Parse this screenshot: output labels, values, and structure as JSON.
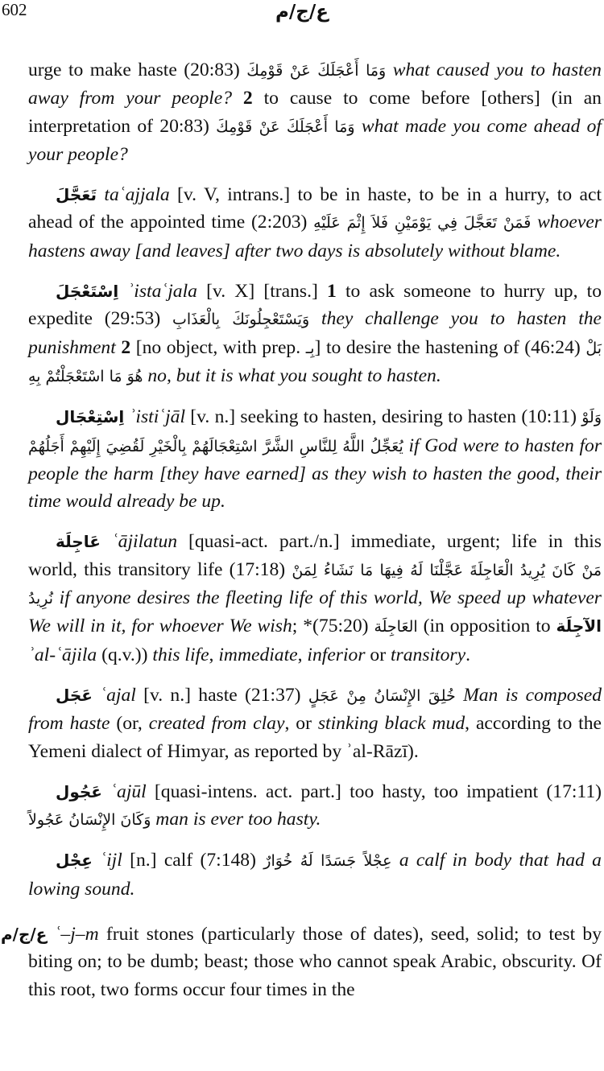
{
  "page_number": "602",
  "running_head": "ع/ج/م",
  "entries": [
    {
      "parts": [
        {
          "t": "urge to make haste (20:83) ",
          "s": ""
        },
        {
          "t": "وَمَا أَعْجَلَكَ عَنْ قَوْمِكَ",
          "s": "ar"
        },
        {
          "t": " ",
          "s": ""
        },
        {
          "t": "what caused you to hasten away from your people?",
          "s": "en"
        },
        {
          "t": " ",
          "s": ""
        },
        {
          "t": "2",
          "s": "b"
        },
        {
          "t": " to cause to come before [others] (in an interpretation of 20:83) ",
          "s": ""
        },
        {
          "t": "وَمَا أَعْجَلَكَ عَنْ قَوْمِكَ",
          "s": "ar"
        },
        {
          "t": " ",
          "s": ""
        },
        {
          "t": "what made you come ahead of your people?",
          "s": "en"
        }
      ]
    },
    {
      "parts": [
        {
          "t": "تَعَجَّلَ",
          "s": "ah"
        },
        {
          "t": " ",
          "s": ""
        },
        {
          "t": "taʿajjala",
          "s": "tr"
        },
        {
          "t": " [v. V, intrans.] to be in haste, to be in a hurry, to act ahead of the appointed time (2:203) ",
          "s": ""
        },
        {
          "t": "فَمَنْ تَعَجَّلَ فِي يَوْمَيْنِ فَلاَ إِثْمَ عَلَيْهِ",
          "s": "ar"
        },
        {
          "t": " ",
          "s": ""
        },
        {
          "t": "whoever hastens away [and leaves] after two days is absolutely without blame.",
          "s": "en"
        }
      ]
    },
    {
      "parts": [
        {
          "t": "اِسْتَعْجَلَ",
          "s": "ah"
        },
        {
          "t": " ",
          "s": ""
        },
        {
          "t": "ʾistaʿjala",
          "s": "tr"
        },
        {
          "t": " [v. X] [trans.] ",
          "s": ""
        },
        {
          "t": "1",
          "s": "b"
        },
        {
          "t": " to ask someone to hurry up, to expedite (29:53) ",
          "s": ""
        },
        {
          "t": "وَيَسْتَعْجِلُونَكَ بِالْعَذَابِ",
          "s": "ar"
        },
        {
          "t": " ",
          "s": ""
        },
        {
          "t": "they challenge you to hasten the punishment",
          "s": "en"
        },
        {
          "t": " ",
          "s": ""
        },
        {
          "t": "2",
          "s": "b"
        },
        {
          "t": " [no object, with prep. ",
          "s": ""
        },
        {
          "t": "بِـ",
          "s": "ar"
        },
        {
          "t": "]  to desire the hastening of (46:24) ",
          "s": ""
        },
        {
          "t": "بَلْ هُوَ مَا اسْتَعْجَلْتُمْ بِهِ",
          "s": "ar"
        },
        {
          "t": " ",
          "s": ""
        },
        {
          "t": "no, but it is what you sought to hasten.",
          "s": "en"
        }
      ]
    },
    {
      "parts": [
        {
          "t": "اِسْتِعْجَال",
          "s": "ah"
        },
        {
          "t": " ",
          "s": ""
        },
        {
          "t": "ʾistiʿjāl",
          "s": "tr"
        },
        {
          "t": " [v. n.] seeking to hasten, desiring to hasten (10:11) ",
          "s": ""
        },
        {
          "t": "وَلَوْ يُعَجِّلُ اللَّهُ لِلنَّاسِ الشَّرَّ اسْتِعْجَالَهُمْ بِالْخَيْرِ لَقُضِيَ إِلَيْهِمْ أَجَلُهُمْ",
          "s": "ar"
        },
        {
          "t": " ",
          "s": ""
        },
        {
          "t": "if God were to hasten for people the harm [they have earned] as they wish to hasten the good, their time would already be up.",
          "s": "en"
        }
      ]
    },
    {
      "parts": [
        {
          "t": "عَاجِلَة",
          "s": "ah"
        },
        {
          "t": " ",
          "s": ""
        },
        {
          "t": "ʿājilatun",
          "s": "tr"
        },
        {
          "t": " [quasi-act. part./n.] immediate, urgent; life in this world, this transitory life (17:18) ",
          "s": ""
        },
        {
          "t": "مَنْ كَانَ يُرِيدُ الْعَاجِلَةَ عَجَّلْنَا لَهُ فِيهَا مَا نَشَاءُ لِمَنْ نُرِيدُ",
          "s": "ar"
        },
        {
          "t": " ",
          "s": ""
        },
        {
          "t": "if anyone desires the fleeting life of this world, We speed up whatever We will in it, for whoever We wish",
          "s": "en"
        },
        {
          "t": "; *(75:20) ",
          "s": ""
        },
        {
          "t": "العَاجِلَة",
          "s": "ar"
        },
        {
          "t": " (in opposition to ",
          "s": ""
        },
        {
          "t": "الآجِلَة",
          "s": "ah"
        },
        {
          "t": " ",
          "s": ""
        },
        {
          "t": "ʾal-ʿājila",
          "s": "tr"
        },
        {
          "t": " (q.v.)) ",
          "s": ""
        },
        {
          "t": "this life",
          "s": "en"
        },
        {
          "t": ", ",
          "s": ""
        },
        {
          "t": "immediate",
          "s": "en"
        },
        {
          "t": ", ",
          "s": ""
        },
        {
          "t": "inferior",
          "s": "en"
        },
        {
          "t": " or ",
          "s": ""
        },
        {
          "t": "transitory",
          "s": "en"
        },
        {
          "t": ".",
          "s": ""
        }
      ]
    },
    {
      "parts": [
        {
          "t": "عَجَل",
          "s": "ah"
        },
        {
          "t": " ",
          "s": ""
        },
        {
          "t": "ʿajal",
          "s": "tr"
        },
        {
          "t": " [v. n.] haste (21:37) ",
          "s": ""
        },
        {
          "t": "خُلِقَ الإِنْسَانُ مِنْ عَجَلٍ",
          "s": "ar"
        },
        {
          "t": " ",
          "s": ""
        },
        {
          "t": "Man is composed from haste",
          "s": "en"
        },
        {
          "t": " (or, ",
          "s": ""
        },
        {
          "t": "created from clay",
          "s": "en"
        },
        {
          "t": ", or ",
          "s": ""
        },
        {
          "t": "stinking black mud",
          "s": "en"
        },
        {
          "t": ", according to the Yemeni dialect of Himyar, as reported by ʾal-Rāzī).",
          "s": ""
        }
      ]
    },
    {
      "parts": [
        {
          "t": "عَجُول",
          "s": "ah"
        },
        {
          "t": " ",
          "s": ""
        },
        {
          "t": "ʿajūl",
          "s": "tr"
        },
        {
          "t": " [quasi-intens. act. part.] too hasty, too impatient (17:11) ",
          "s": ""
        },
        {
          "t": "وَكَانَ الإِنْسَانُ عَجُولاً",
          "s": "ar"
        },
        {
          "t": " ",
          "s": ""
        },
        {
          "t": "man is ever too hasty.",
          "s": "en"
        }
      ]
    },
    {
      "parts": [
        {
          "t": "عِجْل",
          "s": "ah"
        },
        {
          "t": " ",
          "s": ""
        },
        {
          "t": "ʿijl",
          "s": "tr"
        },
        {
          "t": " [n.] calf (7:148) ",
          "s": ""
        },
        {
          "t": "عِجْلاً جَسَدًا لَهُ خُوَارٌ",
          "s": "ar"
        },
        {
          "t": " ",
          "s": ""
        },
        {
          "t": "a calf in body that had a lowing sound.",
          "s": "en"
        }
      ]
    },
    {
      "root": true,
      "parts": [
        {
          "t": "ع/ج/م",
          "s": "ah"
        },
        {
          "t": " ",
          "s": ""
        },
        {
          "t": "ʿ–j–m",
          "s": "tr"
        },
        {
          "t": " fruit stones (particularly those of dates), seed, solid; to test by biting on; to be dumb; beast; those who cannot speak Arabic, obscurity. Of this root, two forms occur four times in the",
          "s": ""
        }
      ]
    }
  ]
}
